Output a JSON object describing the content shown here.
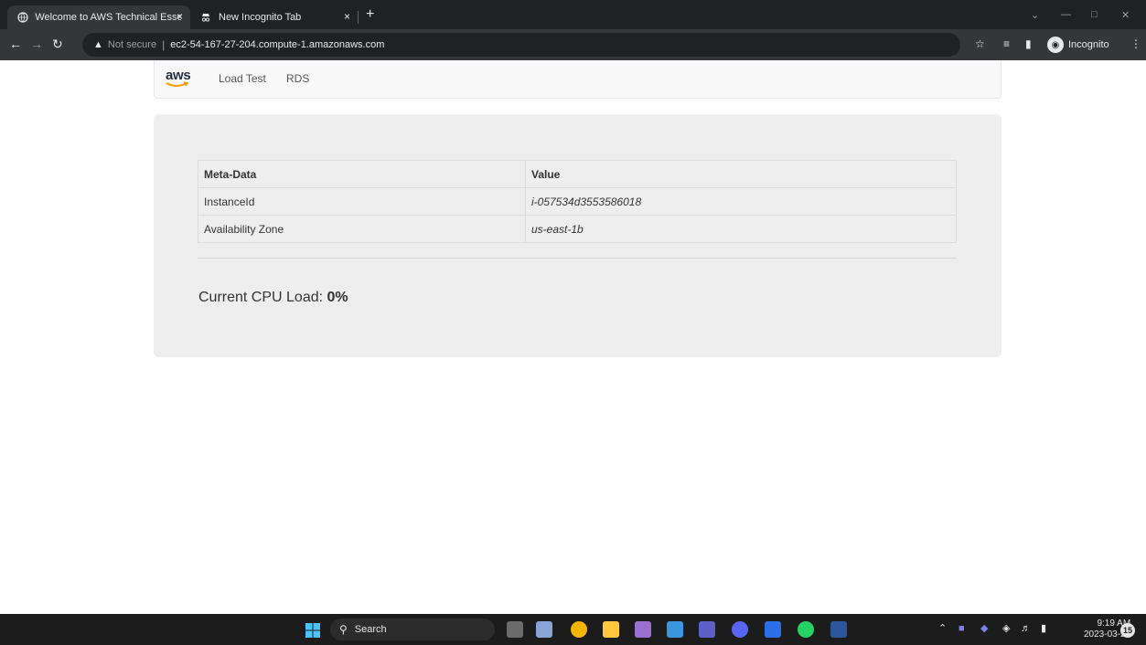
{
  "browser": {
    "tabs": [
      {
        "title": "Welcome to AWS Technical Essen",
        "active": true
      },
      {
        "title": "New Incognito Tab",
        "active": false
      }
    ],
    "new_tab_symbol": "+",
    "close_symbol": "×",
    "omnibox": {
      "security_label": "Not secure",
      "url": "ec2-54-167-27-204.compute-1.amazonaws.com"
    },
    "profile_label": "Incognito"
  },
  "navbar": {
    "logo_text": "aws",
    "links": [
      "Load Test",
      "RDS"
    ]
  },
  "metadata_table": {
    "headers": [
      "Meta-Data",
      "Value"
    ],
    "rows": [
      {
        "key": "InstanceId",
        "value": "i-057534d3553586018"
      },
      {
        "key": "Availability Zone",
        "value": "us-east-1b"
      }
    ]
  },
  "cpu": {
    "label": "Current CPU Load: ",
    "value": "0%"
  },
  "taskbar": {
    "search_placeholder": "Search",
    "time": "9:19 AM",
    "date": "2023-03-23",
    "notification_count": "15"
  },
  "colors": {
    "chrome_dark": "#202124",
    "chrome_toolbar": "#35363a",
    "aws_orange": "#ff9900",
    "jumbotron": "#eeeeee"
  }
}
